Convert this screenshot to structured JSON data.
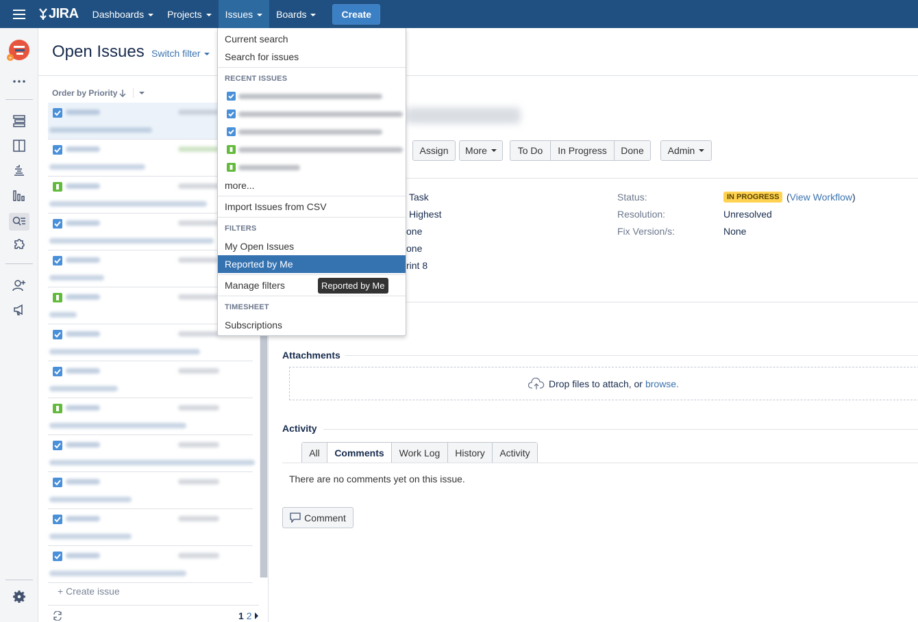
{
  "nav": {
    "logo_text": "JIRA",
    "items": [
      {
        "label": "Dashboards"
      },
      {
        "label": "Projects"
      },
      {
        "label": "Issues"
      },
      {
        "label": "Boards"
      }
    ],
    "create_label": "Create"
  },
  "sidebar": {
    "icons": [
      "project-avatar",
      "more-icon",
      "backlog-icon",
      "board-icon",
      "releases-icon",
      "reports-icon",
      "issues-icon",
      "add-ons-icon",
      "add-people-icon",
      "feedback-icon",
      "settings-icon"
    ]
  },
  "list": {
    "title": "Open Issues",
    "switch_filter": "Switch filter",
    "order_by": "Order by Priority",
    "create_issue": "+ Create issue",
    "pager": {
      "current": "1",
      "next": "2"
    },
    "rows": [
      {
        "type": "task"
      },
      {
        "type": "task"
      },
      {
        "type": "story"
      },
      {
        "type": "task"
      },
      {
        "type": "task"
      },
      {
        "type": "story"
      },
      {
        "type": "task"
      },
      {
        "type": "task"
      },
      {
        "type": "story"
      },
      {
        "type": "task"
      },
      {
        "type": "task"
      },
      {
        "type": "task"
      },
      {
        "type": "task"
      }
    ]
  },
  "issue": {
    "buttons": {
      "assign": "Assign",
      "more": "More",
      "todo": "To Do",
      "in_progress": "In Progress",
      "done": "Done",
      "admin": "Admin"
    },
    "fields_left": [
      "Task",
      "Highest",
      "one",
      "one",
      "rint 8"
    ],
    "status_label": "Status:",
    "status_value": "IN PROGRESS",
    "view_workflow": "View Workflow",
    "resolution_label": "Resolution:",
    "resolution_value": "Unresolved",
    "fix_label": "Fix Version/s:",
    "fix_value": "None",
    "attachments_title": "Attachments",
    "drop_text": "Drop files to attach, or",
    "browse": "browse.",
    "activity_title": "Activity",
    "tabs": [
      "All",
      "Comments",
      "Work Log",
      "History",
      "Activity"
    ],
    "active_tab": "Comments",
    "no_comments": "There are no comments yet on this issue.",
    "comment_button": "Comment"
  },
  "issues_menu": {
    "current_search": "Current search",
    "search_for_issues": "Search for issues",
    "recent_heading": "RECENT ISSUES",
    "recent": [
      {
        "type": "task"
      },
      {
        "type": "task"
      },
      {
        "type": "task"
      },
      {
        "type": "story"
      },
      {
        "type": "story"
      }
    ],
    "more": "more...",
    "import_csv": "Import Issues from CSV",
    "filters_heading": "FILTERS",
    "my_open_issues": "My Open Issues",
    "reported_by_me": "Reported by Me",
    "manage_filters": "Manage filters",
    "timesheet_heading": "TIMESHEET",
    "subscriptions": "Subscriptions"
  },
  "tooltip": "Reported by Me",
  "colors": {
    "nav": "#205081",
    "highlight": "#3572b0",
    "link": "#3b73af",
    "status": "#ffd351"
  }
}
